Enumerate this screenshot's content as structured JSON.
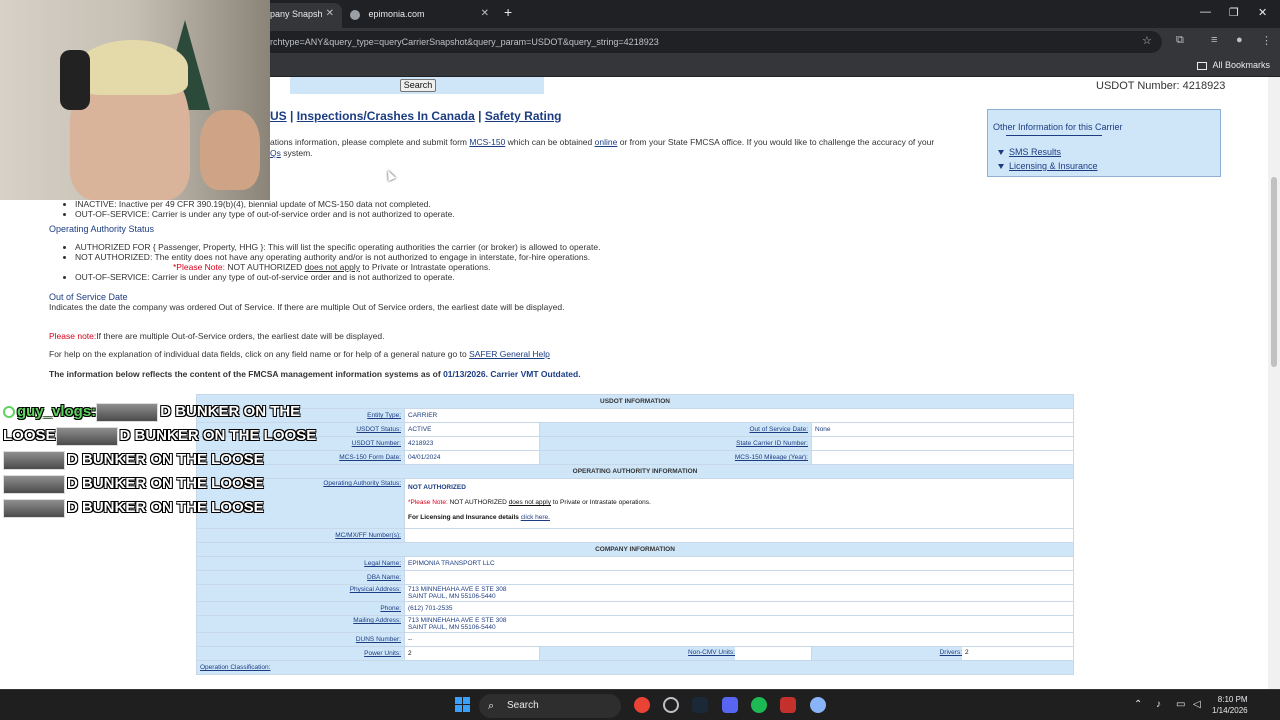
{
  "browser": {
    "tabs": [
      {
        "title": "pany Snapsh",
        "active": true
      },
      {
        "title": "epimonia.com",
        "active": false
      }
    ],
    "url": "rchtype=ANY&query_type=queryCarrierSnapshot&query_param=USDOT&query_string=4218923",
    "bookmarks_label": "All Bookmarks",
    "new_tab": "+",
    "window_controls": [
      "—",
      "❐",
      "✕"
    ]
  },
  "page": {
    "search_button": "Search",
    "usdot_header": "USDOT Number: 4218923",
    "nav": {
      "us": "US",
      "canada": "Inspections/Crashes In Canada",
      "safety": "Safety Rating",
      "sep": "|"
    },
    "intro": {
      "text1": "ations information, please complete and submit form",
      "mcs150": "MCS-150",
      "text2": "which can be obtained",
      "online": "online",
      "text3": "or from your State FMCSA office. If you would like to challenge the accuracy of your",
      "faqs": "Qs",
      "text4": "system."
    },
    "other_info": {
      "title": "Other Information for this Carrier",
      "links": [
        "SMS Results",
        "Licensing & Insurance"
      ]
    },
    "status_list": [
      {
        "term": "INACTIVE",
        "desc": ": Inactive per 49 CFR 390.19(b)(4), biennial update of MCS-150 data not completed."
      },
      {
        "term": "OUT-OF-SERVICE",
        "desc": ": Carrier is under any type of out-of-service order and is not authorized to operate."
      }
    ],
    "operating_authority": {
      "heading": "Operating Authority Status",
      "authorized_term": "AUTHORIZED FOR { Passenger, Property, HHG }",
      "authorized_desc": ": This will list the specific operating authorities the carrier (or broker) is allowed to operate.",
      "not_term": "NOT AUTHORIZED",
      "not_desc": ": The entity does not have any operating authority and/or is not authorized to engage in interstate, for-hire operations.",
      "note_label": "*Please Note:",
      "note_bold": "NOT AUTHORIZED",
      "note_link": "does not apply",
      "note_rest1": "to",
      "note_private": "Private",
      "note_or": "or",
      "note_intra": "Intrastate",
      "note_end": "operations.",
      "oos_term": "OUT-OF-SERVICE",
      "oos_desc": ": Carrier is under any type of out-of-service order and is not authorized to operate."
    },
    "oos_date": {
      "heading": "Out of Service Date",
      "desc": "Indicates the date the company was ordered Out of Service. If there are multiple Out of Service orders, the earliest date will be displayed."
    },
    "please_note": {
      "label": "Please note:",
      "text": "If there are multiple Out-of-Service orders, the earliest date will be displayed."
    },
    "help": {
      "text": "For help on the explanation of individual data fields, click on any field name or for help of a general nature go to",
      "link": "SAFER General Help"
    },
    "reflects": {
      "text": "The information below reflects the content of the FMCSA management information systems as of",
      "date": "01/13/2026.",
      "vmt": "Carrier VMT Outdated."
    },
    "snapshot": {
      "usdot_info": "USDOT INFORMATION",
      "entity_type_label": "Entity Type:",
      "entity_type": "CARRIER",
      "usdot_status_label": "USDOT Status:",
      "usdot_status": "ACTIVE",
      "oos_date_label": "Out of Service Date:",
      "oos_date": "None",
      "usdot_number_label": "USDOT Number:",
      "usdot_number": "4218923",
      "state_id_label": "State Carrier ID Number:",
      "state_id": "",
      "mcs150_date_label": "MCS-150 Form Date:",
      "mcs150_date": "04/01/2024",
      "mcs150_mileage_label": "MCS-150 Mileage (Year):",
      "mcs150_mileage": "",
      "op_auth_info": "OPERATING AUTHORITY INFORMATION",
      "op_auth_status_label": "Operating Authority Status:",
      "op_auth_status": "NOT AUTHORIZED",
      "op_note_label": "*Please Note:",
      "op_note_bold": "NOT AUTHORIZED",
      "op_note_link": "does not apply",
      "op_note_to": "to",
      "op_note_private": "Private",
      "op_note_or": "or",
      "op_note_intra": "Intrastate",
      "op_note_end": "operations.",
      "li_text": "For Licensing and Insurance details",
      "li_link": "click here.",
      "mc_label": "MC/MX/FF Number(s):",
      "mc": "",
      "company_info": "COMPANY INFORMATION",
      "legal_name_label": "Legal Name:",
      "legal_name": "EPIMONIA TRANSPORT LLC",
      "dba_label": "DBA Name:",
      "dba": "",
      "phys_label": "Physical Address:",
      "phys_line1": "713 MINNEHAHA AVE E STE 308",
      "phys_line2": "SAINT PAUL, MN   55106-5440",
      "phone_label": "Phone:",
      "phone": "(612) 701-2535",
      "mail_label": "Mailing Address:",
      "mail_line1": "713 MINNEHAHA AVE E STE 308",
      "mail_line2": "SAINT PAUL, MN   55106-5440",
      "duns_label": "DUNS Number:",
      "duns": "--",
      "power_label": "Power Units:",
      "power": "2",
      "noncmv_label": "Non-CMV Units:",
      "noncmv": "",
      "drivers_label": "Drivers:",
      "drivers": "2",
      "op_class_label": "Operation Classification:"
    }
  },
  "chat": {
    "username": "guy_vlogs:",
    "message": "D BUNKER ON THE LOOSE",
    "line1_a": "D BUNKER ON THE",
    "line2_a": "LOOSE",
    "line2_b": "D BUNKER ON THE LOOSE"
  },
  "taskbar": {
    "search_label": "Search",
    "time": "8:10 PM",
    "date": "1/14/2026"
  },
  "colors": {
    "accent_blue": "#1c3d82",
    "table_blue": "#cfe6f8",
    "red_note": "#d8001a",
    "chat_user": "#5fd35f"
  }
}
